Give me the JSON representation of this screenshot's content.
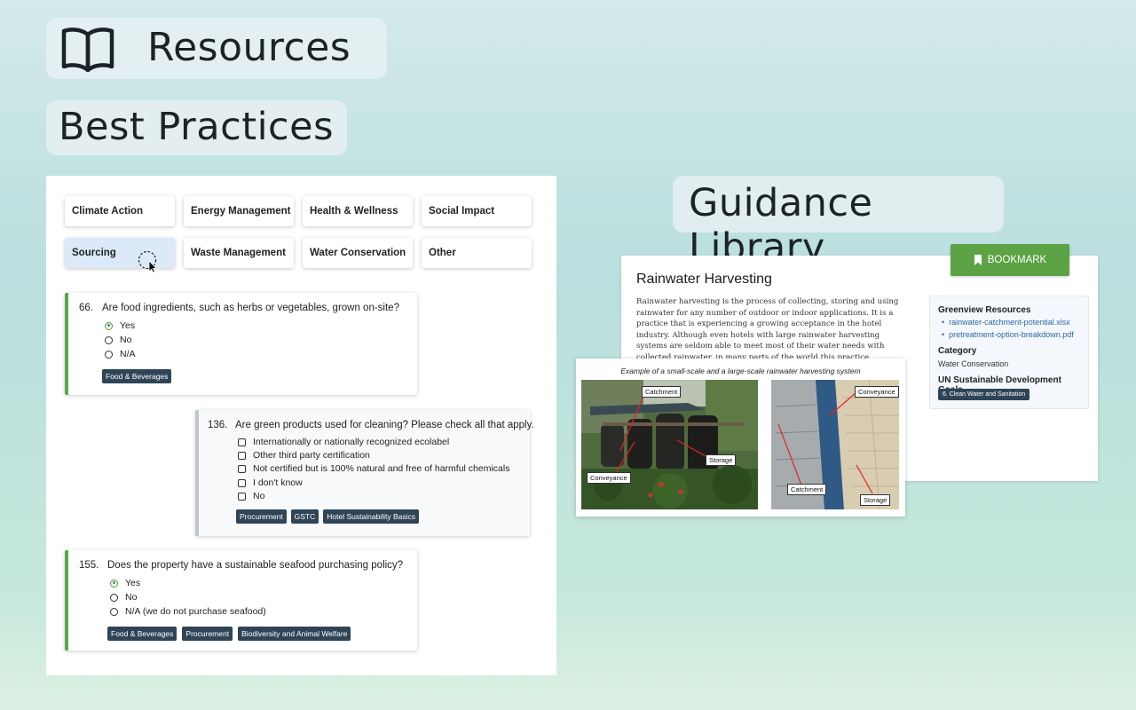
{
  "headers": {
    "resources": "Resources",
    "best_practices": "Best Practices",
    "guidance_library": "Guidance Library"
  },
  "categories": [
    "Climate Action",
    "Energy Management",
    "Health & Wellness",
    "Social Impact",
    "Sourcing",
    "Waste Management",
    "Water Conservation",
    "Other"
  ],
  "active_category": "Sourcing",
  "questions": [
    {
      "number": "66.",
      "text": "Are food ingredients, such as herbs or vegetables, grown on-site?",
      "options": [
        "Yes",
        "No",
        "N/A"
      ],
      "selected": "Yes",
      "tags": [
        "Food & Beverages"
      ]
    },
    {
      "number": "136.",
      "text": "Are green products used for cleaning? Please check all that apply.",
      "options": [
        "Internationally or nationally recognized ecolabel",
        "Other third party certification",
        "Not certified but is 100% natural and free of harmful chemicals",
        "I don't know",
        "No"
      ],
      "tags": [
        "Procurement",
        "GSTC",
        "Hotel Sustainability Basics"
      ]
    },
    {
      "number": "155.",
      "text": "Does the property have a sustainable seafood purchasing policy?",
      "options": [
        "Yes",
        "No",
        "N/A (we do not purchase seafood)"
      ],
      "selected": "Yes",
      "tags": [
        "Food & Beverages",
        "Procurement",
        "Biodiversity and Animal Welfare"
      ]
    }
  ],
  "article": {
    "bookmark_label": "BOOKMARK",
    "title": "Rainwater Harvesting",
    "body": "Rainwater harvesting is the process of collecting, storing and using rainwater for any number of outdoor or indoor applications. It is a practice that is experiencing a growing acceptance in the hotel industry. Although even hotels with large rainwater harvesting systems are seldom able to meet most of their water needs with collected rainwater, in many parts of the world this practice...",
    "sidebar": {
      "resources_heading": "Greenview Resources",
      "resources": [
        "rainwater-catchment-potential.xlsx",
        "pretreatment-option-breakdown.pdf"
      ],
      "category_heading": "Category",
      "category": "Water Conservation",
      "sdg_heading": "UN Sustainable Development Goals",
      "sdg_tag": "6. Clean Water and Sanitation"
    },
    "figure": {
      "caption": "Example of a small-scale and a large-scale rainwater harvesting system",
      "left_labels": [
        "Catchment",
        "Storage",
        "Conveyance"
      ],
      "right_labels": [
        "Conveyance",
        "Catchment",
        "Storage"
      ]
    }
  },
  "colors": {
    "accent_green": "#5ba345",
    "tag_navy": "#2f4557",
    "link_blue": "#2b66a8",
    "active_category_bg": "#dbe9f9"
  }
}
